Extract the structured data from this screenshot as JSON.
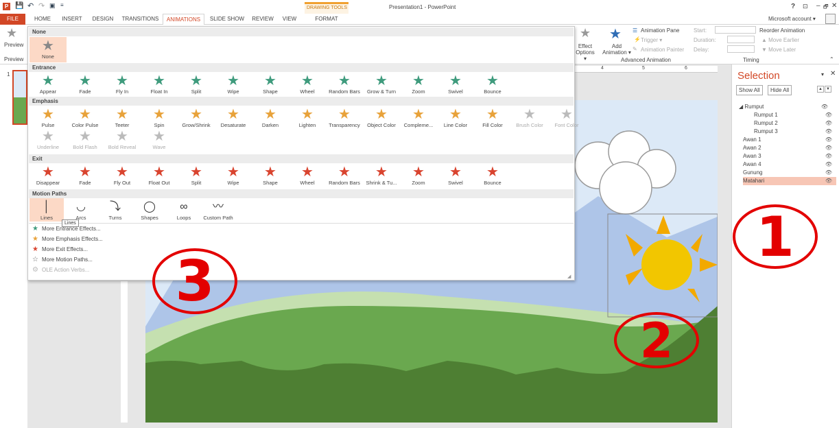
{
  "window": {
    "title": "Presentation1 - PowerPoint",
    "context_tab_group": "DRAWING TOOLS",
    "controls": [
      "?",
      "⊡",
      "–",
      "🗗",
      "✕"
    ],
    "account": "Microsoft account ▾"
  },
  "tabs": [
    "FILE",
    "HOME",
    "INSERT",
    "DESIGN",
    "TRANSITIONS",
    "ANIMATIONS",
    "SLIDE SHOW",
    "REVIEW",
    "VIEW",
    "FORMAT"
  ],
  "ribbon": {
    "preview_label": "Preview",
    "preview_group": "Preview",
    "effect_options": "Effect Options ▾",
    "add_animation": "Add Animation ▾",
    "animation_pane": "Animation Pane",
    "trigger": "Trigger ▾",
    "animation_painter": "Animation Painter",
    "advanced_group": "Advanced Animation",
    "start_label": "Start:",
    "duration_label": "Duration:",
    "delay_label": "Delay:",
    "reorder": "Reorder Animation",
    "move_earlier": "▲ Move Earlier",
    "move_later": "▼ Move Later",
    "timing_group": "Timing"
  },
  "ruler": [
    "4",
    "5",
    "6"
  ],
  "slide_number": "1",
  "gallery": {
    "none_header": "None",
    "none_item": "None",
    "entrance_header": "Entrance",
    "entrance": [
      "Appear",
      "Fade",
      "Fly In",
      "Float In",
      "Split",
      "Wipe",
      "Shape",
      "Wheel",
      "Random Bars",
      "Grow & Turn",
      "Zoom",
      "Swivel",
      "Bounce"
    ],
    "emphasis_header": "Emphasis",
    "emphasis_row1": [
      "Pulse",
      "Color Pulse",
      "Teeter",
      "Spin",
      "Grow/Shrink",
      "Desaturate",
      "Darken",
      "Lighten",
      "Transparency",
      "Object Color",
      "Compleme...",
      "Line Color",
      "Fill Color",
      "Brush Color",
      "Font Color"
    ],
    "emphasis_row2": [
      "Underline",
      "Bold Flash",
      "Bold Reveal",
      "Wave"
    ],
    "exit_header": "Exit",
    "exit": [
      "Disappear",
      "Fade",
      "Fly Out",
      "Float Out",
      "Split",
      "Wipe",
      "Shape",
      "Wheel",
      "Random Bars",
      "Shrink & Tu...",
      "Zoom",
      "Swivel",
      "Bounce"
    ],
    "motion_header": "Motion Paths",
    "motion": [
      "Lines",
      "Arcs",
      "Turns",
      "Shapes",
      "Loops",
      "Custom Path"
    ],
    "more": [
      "More Entrance Effects...",
      "More Emphasis Effects...",
      "More Exit Effects...",
      "More Motion Paths...",
      "OLE Action Verbs..."
    ],
    "tooltip": "Lines"
  },
  "colors": {
    "entrance": "#3f9b7d",
    "emphasis": "#e8a23a",
    "exit": "#d9442f",
    "accent": "#d24726",
    "annotation": "#e30000"
  },
  "selection_pane": {
    "title": "Selection",
    "show_all": "Show All",
    "hide_all": "Hide All",
    "items": [
      "◢ Rumput",
      "Rumput 1",
      "Rumput 2",
      "Rumput 3",
      "Awan 1",
      "Awan 2",
      "Awan 3",
      "Awan 4",
      "Gunung",
      "Matahari"
    ]
  },
  "annotations": [
    "1",
    "2",
    "3"
  ]
}
